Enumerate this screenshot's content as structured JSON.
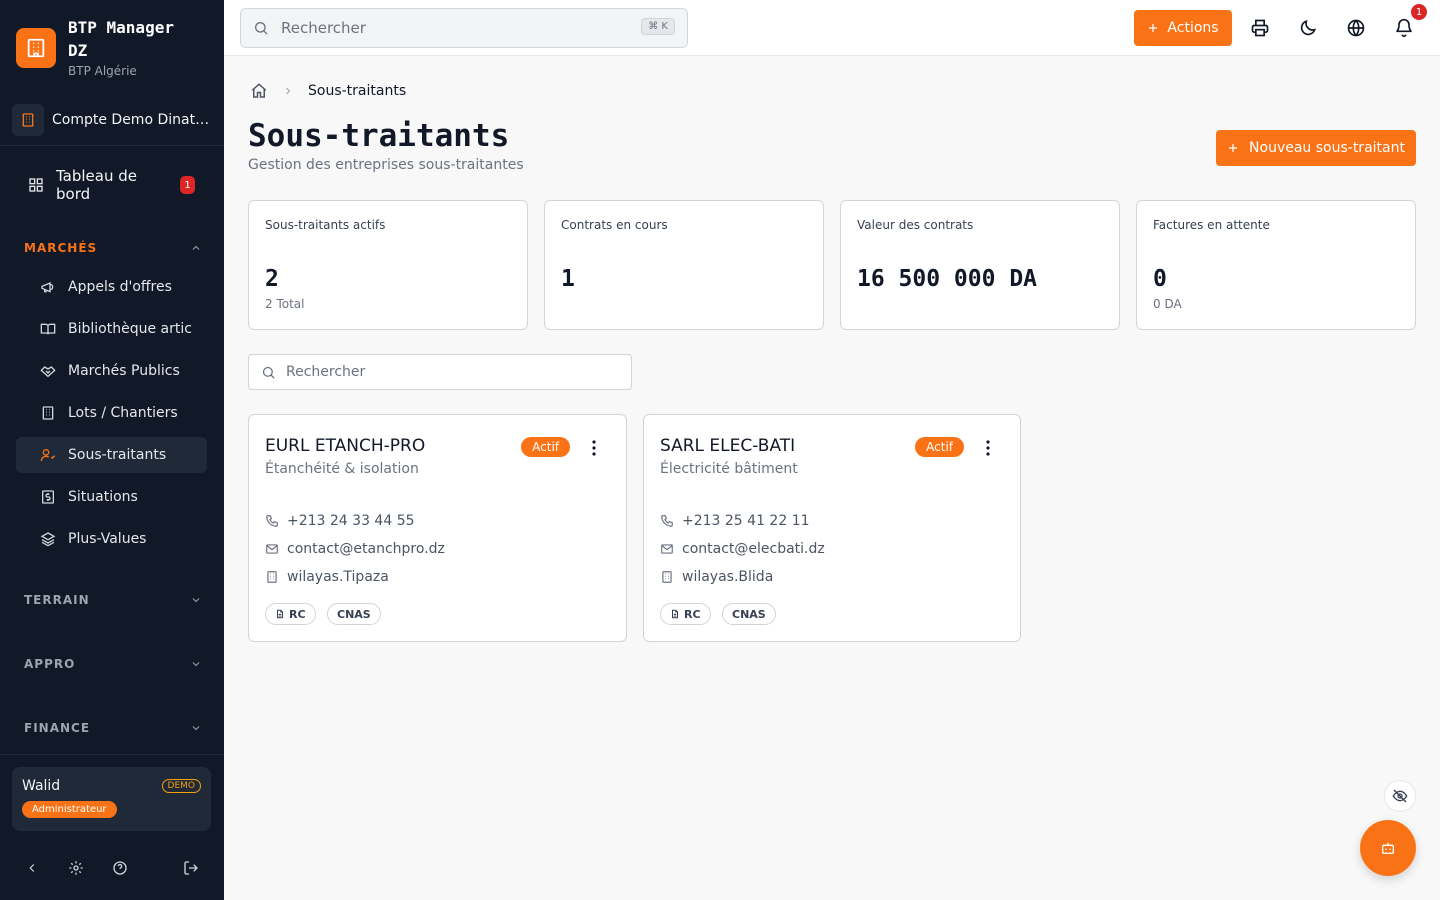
{
  "app": {
    "name": "BTP Manager DZ",
    "subtitle": "BTP Algérie",
    "account": "Compte Demo Dinatec Informatique"
  },
  "nav": {
    "dashboard": {
      "label": "Tableau de bord",
      "badge": "1"
    },
    "sections": [
      {
        "label": "MARCHÉS",
        "expanded": true
      },
      {
        "label": "TERRAIN",
        "expanded": false
      },
      {
        "label": "APPRO",
        "expanded": false
      },
      {
        "label": "FINANCE",
        "expanded": false
      }
    ],
    "items": [
      {
        "label": "Appels d'offres",
        "icon": "megaphone-icon"
      },
      {
        "label": "Bibliothèque artic",
        "icon": "book-icon"
      },
      {
        "label": "Marchés Publics",
        "icon": "handshake-icon"
      },
      {
        "label": "Lots / Chantiers",
        "icon": "building-icon"
      },
      {
        "label": "Sous-traitants",
        "icon": "user-cog-icon",
        "active": true
      },
      {
        "label": "Situations",
        "icon": "receipt-icon"
      },
      {
        "label": "Plus-Values",
        "icon": "layers-icon"
      }
    ]
  },
  "user": {
    "name": "Walid",
    "tag": "DEMO",
    "role": "Administrateur"
  },
  "topbar": {
    "search_placeholder": "Rechercher",
    "shortcut": "⌘ K",
    "actions_label": "Actions",
    "notifications_count": "1"
  },
  "breadcrumb": {
    "current": "Sous-traitants"
  },
  "page": {
    "title": "Sous-traitants",
    "subtitle": "Gestion des entreprises sous-traitantes",
    "new_button": "Nouveau sous-traitant"
  },
  "stats": [
    {
      "label": "Sous-traitants actifs",
      "value": "2",
      "sub": "2 Total"
    },
    {
      "label": "Contrats en cours",
      "value": "1",
      "sub": ""
    },
    {
      "label": "Valeur des contrats",
      "value": "16 500 000 DA",
      "sub": ""
    },
    {
      "label": "Factures en attente",
      "value": "0",
      "sub": "0 DA"
    }
  ],
  "list": {
    "search_placeholder": "Rechercher"
  },
  "subcontractors": [
    {
      "name": "EURL ETANCH-PRO",
      "specialty": "Étanchéité & isolation",
      "status": "Actif",
      "phone": "+213 24 33 44 55",
      "email": "contact@etanchpro.dz",
      "wilaya": "wilayas.Tipaza",
      "docs": [
        "RC",
        "CNAS"
      ]
    },
    {
      "name": "SARL ELEC-BATI",
      "specialty": "Électricité bâtiment",
      "status": "Actif",
      "phone": "+213 25 41 22 11",
      "email": "contact@elecbati.dz",
      "wilaya": "wilayas.Blida",
      "docs": [
        "RC",
        "CNAS"
      ]
    }
  ],
  "colors": {
    "accent": "#f97316",
    "sidebar": "#111827",
    "danger": "#dc2626"
  }
}
